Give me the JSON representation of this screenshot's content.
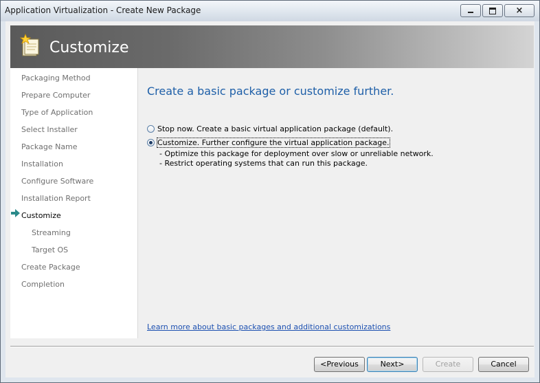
{
  "window": {
    "title": "Application Virtualization - Create New Package",
    "controls": {
      "minimize_icon": "minimize-icon",
      "maximize_icon": "maximize-icon",
      "close_glyph": "×"
    }
  },
  "banner": {
    "title": "Customize",
    "icon": "package-wizard-icon"
  },
  "sidebar": {
    "current_marker_icon": "arrow-right-icon",
    "items": [
      {
        "label": "Packaging Method",
        "state": "done"
      },
      {
        "label": "Prepare Computer",
        "state": "done"
      },
      {
        "label": "Type of Application",
        "state": "done"
      },
      {
        "label": "Select Installer",
        "state": "done"
      },
      {
        "label": "Package Name",
        "state": "done"
      },
      {
        "label": "Installation",
        "state": "done"
      },
      {
        "label": "Configure Software",
        "state": "done"
      },
      {
        "label": "Installation Report",
        "state": "done"
      },
      {
        "label": "Customize",
        "state": "current"
      },
      {
        "label": "Streaming",
        "state": "pending",
        "sub": true
      },
      {
        "label": "Target OS",
        "state": "pending",
        "sub": true
      },
      {
        "label": "Create Package",
        "state": "pending"
      },
      {
        "label": "Completion",
        "state": "pending"
      }
    ]
  },
  "main": {
    "heading": "Create a basic package or customize further.",
    "options": [
      {
        "label": "Stop now.  Create a basic virtual application package (default).",
        "checked": false
      },
      {
        "label": "Customize.  Further configure the virtual application package.",
        "checked": true
      }
    ],
    "customize_details": [
      "- Optimize this package for deployment over slow or unreliable network.",
      "- Restrict operating systems that can run this package."
    ],
    "learn_more_link": "Learn more about basic packages and additional customizations"
  },
  "buttons": {
    "previous": "<Previous",
    "next": "Next>",
    "create": "Create",
    "cancel": "Cancel"
  },
  "colors": {
    "heading": "#1e5fa8",
    "link": "#1b4fb0",
    "arrow": "#2a8a8a",
    "sidebar_done": "#6f6f6f",
    "sidebar_current": "#000000"
  }
}
